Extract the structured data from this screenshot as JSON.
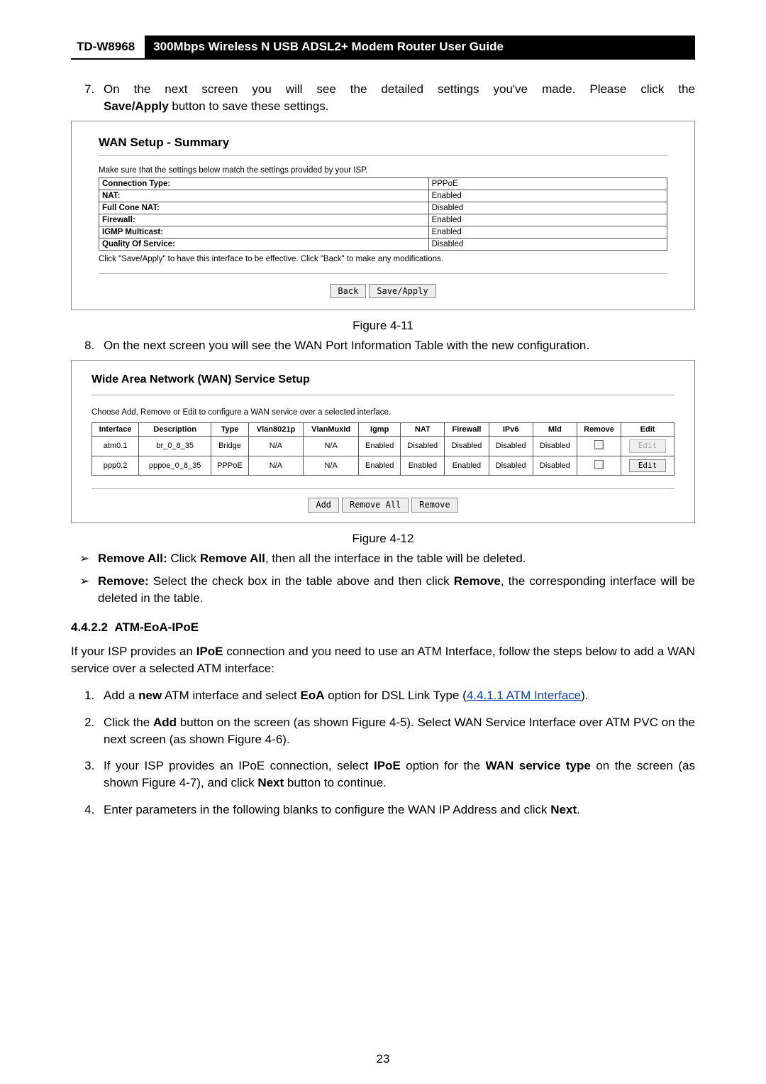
{
  "header": {
    "model": "TD-W8968",
    "title": "300Mbps Wireless N USB ADSL2+ Modem Router User Guide"
  },
  "step7": {
    "number": "7.",
    "text_a": "On the next screen you will see the detailed settings you've made. Please click the",
    "text_b": "Save/Apply",
    "text_c": " button to save these settings."
  },
  "fig11": {
    "title": "WAN Setup - Summary",
    "note": "Make sure that the settings below match the settings provided by your ISP.",
    "rows": [
      {
        "label": "Connection Type:",
        "value": "PPPoE"
      },
      {
        "label": "NAT:",
        "value": "Enabled"
      },
      {
        "label": "Full Cone NAT:",
        "value": "Disabled"
      },
      {
        "label": "Firewall:",
        "value": "Enabled"
      },
      {
        "label": "IGMP Multicast:",
        "value": "Enabled"
      },
      {
        "label": "Quality Of Service:",
        "value": "Disabled"
      }
    ],
    "footnote": "Click \"Save/Apply\" to have this interface to be effective. Click \"Back\" to make any modifications.",
    "btn_back": "Back",
    "btn_save": "Save/Apply",
    "caption": "Figure 4-11"
  },
  "step8": {
    "number": "8.",
    "text": "On the next screen you will see the WAN Port Information Table with the new configuration."
  },
  "fig12": {
    "title": "Wide Area Network (WAN) Service Setup",
    "note": "Choose Add, Remove or Edit to configure a WAN service over a selected interface.",
    "headers": [
      "Interface",
      "Description",
      "Type",
      "Vlan8021p",
      "VlanMuxId",
      "Igmp",
      "NAT",
      "Firewall",
      "IPv6",
      "Mld",
      "Remove",
      "Edit"
    ],
    "rows": [
      {
        "cells": [
          "atm0.1",
          "br_0_8_35",
          "Bridge",
          "N/A",
          "N/A",
          "Enabled",
          "Disabled",
          "Disabled",
          "Disabled",
          "Disabled"
        ],
        "edit_disabled": true
      },
      {
        "cells": [
          "ppp0.2",
          "pppoe_0_8_35",
          "PPPoE",
          "N/A",
          "N/A",
          "Enabled",
          "Enabled",
          "Enabled",
          "Disabled",
          "Disabled"
        ],
        "edit_disabled": false
      }
    ],
    "btn_add": "Add",
    "btn_remove_all": "Remove All",
    "btn_remove": "Remove",
    "btn_edit": "Edit",
    "caption": "Figure 4-12"
  },
  "bullets": {
    "remove_all": {
      "label": "Remove All:",
      "text_a": " Click ",
      "bold": "Remove All",
      "text_b": ", then all the interface in the table will be deleted."
    },
    "remove": {
      "label": "Remove:",
      "text_a": " Select the check box in the table above and then click ",
      "bold": "Remove",
      "text_b": ", the corresponding interface will be deleted in the table."
    }
  },
  "section": {
    "num": "4.4.2.2",
    "title": "ATM-EoA-IPoE"
  },
  "intro": {
    "a": "If your ISP provides an ",
    "b": "IPoE",
    "c": " connection and you need to use an ATM Interface, follow the steps below to add a WAN service over a selected ATM interface:"
  },
  "steps": {
    "s1": {
      "a": "Add a ",
      "b": "new",
      "c": " ATM interface and select ",
      "d": "EoA",
      "e": " option for DSL Link Type (",
      "link": "4.4.1.1 ATM Interface",
      "f": ")."
    },
    "s2": {
      "a": "Click the ",
      "b": "Add",
      "c": " button on the screen (as shown Figure 4-5). Select WAN Service Interface over ATM PVC on the next screen (as shown Figure 4-6)."
    },
    "s3": {
      "a": "If your ISP provides an IPoE connection, select ",
      "b": "IPoE",
      "c": " option for the ",
      "d": "WAN service type",
      "e": " on the screen (as shown Figure 4-7), and click ",
      "f": "Next",
      "g": " button to continue."
    },
    "s4": {
      "a": "Enter parameters in the following blanks to configure the WAN IP Address and click ",
      "b": "Next",
      "c": "."
    }
  },
  "page_no": "23"
}
